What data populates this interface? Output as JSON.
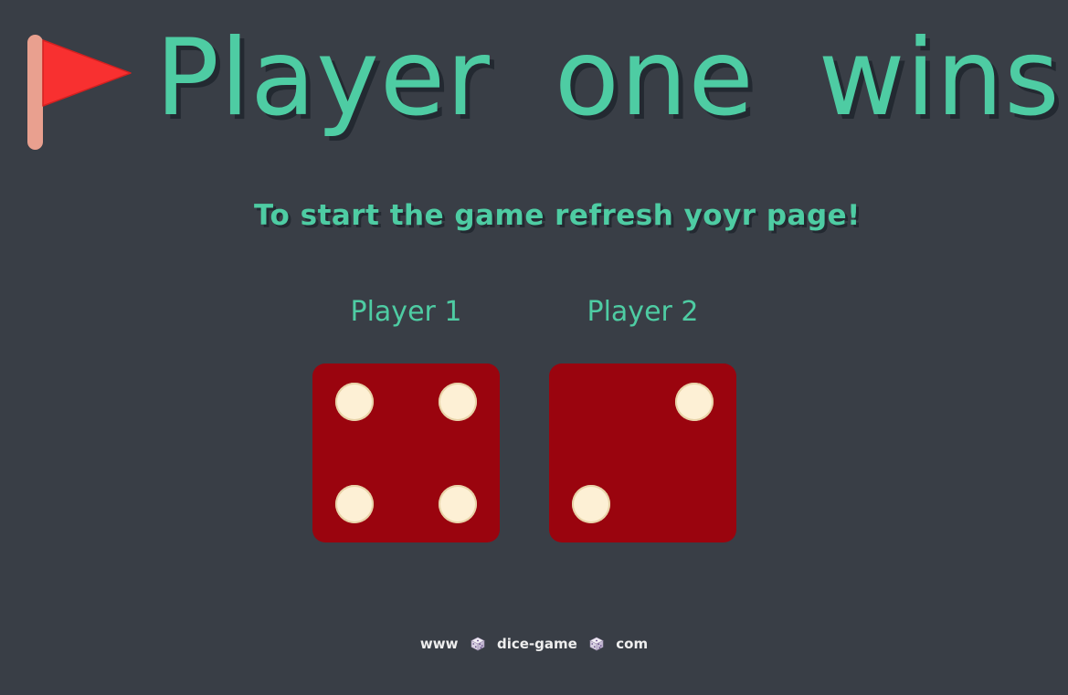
{
  "header": {
    "title": "Player one wins!",
    "subtitle": "To start the game refresh yoyr page!"
  },
  "players": [
    {
      "label": "Player 1",
      "die_value": 4
    },
    {
      "label": "Player 2",
      "die_value": 2
    }
  ],
  "footer": {
    "prefix": "www",
    "middle": "dice-game",
    "suffix": "com"
  },
  "icons": {
    "flag": "red-flag-icon",
    "separator": "game-die-icon"
  },
  "colors": {
    "background": "#393e46",
    "accent": "#4ecca3",
    "die": "#9a040e",
    "pip": "#fdf0d5",
    "flag": "#f83030",
    "flag_pole": "#e9a08f"
  }
}
